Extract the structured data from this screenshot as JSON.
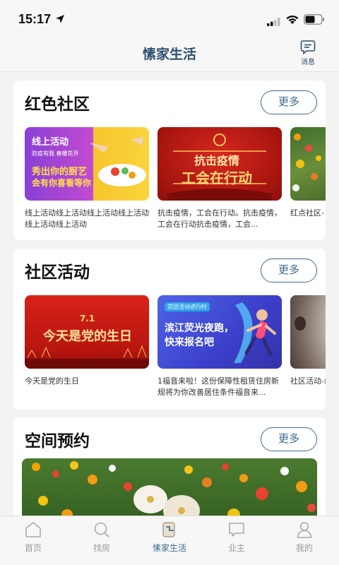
{
  "status": {
    "time": "15:17"
  },
  "header": {
    "title": "愫家生活",
    "messages_label": "消息"
  },
  "sections": [
    {
      "title": "红色社区",
      "more": "更多",
      "items": [
        {
          "caption": "线上活动线上活动线上活动线上活动线上活动线上活动",
          "img_title": "线上活动",
          "img_sub": "防疫有我  春暖花开",
          "img_line1": "秀出你的厨艺",
          "img_line2": "会有你喜看等你"
        },
        {
          "caption": "抗击疫情，工会在行动。抗击疫情，工会在行动抗击疫情，工会...",
          "img_line1": "抗击疫情",
          "img_line2": "工会在行动"
        },
        {
          "caption": "红点社区-"
        }
      ]
    },
    {
      "title": "社区活动",
      "more": "更多",
      "items": [
        {
          "caption": "今天是党的生日",
          "img_date": "7.1",
          "img_line1": "今天是党的生日"
        },
        {
          "caption": "1福音来啦！这份保障性租赁住房新规将为你改善居住条件福音来...",
          "img_tag": "党团活动进行时",
          "img_line1": "滨江荧光夜跑，",
          "img_line2": "快来报名吧"
        },
        {
          "caption": "社区活动-命精神"
        }
      ]
    },
    {
      "title": "空间预约",
      "more": "更多"
    }
  ],
  "tabs": [
    {
      "label": "首页",
      "icon": "home-icon"
    },
    {
      "label": "找房",
      "icon": "search-icon"
    },
    {
      "label": "愫家生活",
      "icon": "life-icon",
      "active": true
    },
    {
      "label": "业主",
      "icon": "chat-icon"
    },
    {
      "label": "我的",
      "icon": "person-icon"
    }
  ],
  "colors": {
    "accent": "#3e6a8f",
    "title": "#2d4f6e"
  }
}
